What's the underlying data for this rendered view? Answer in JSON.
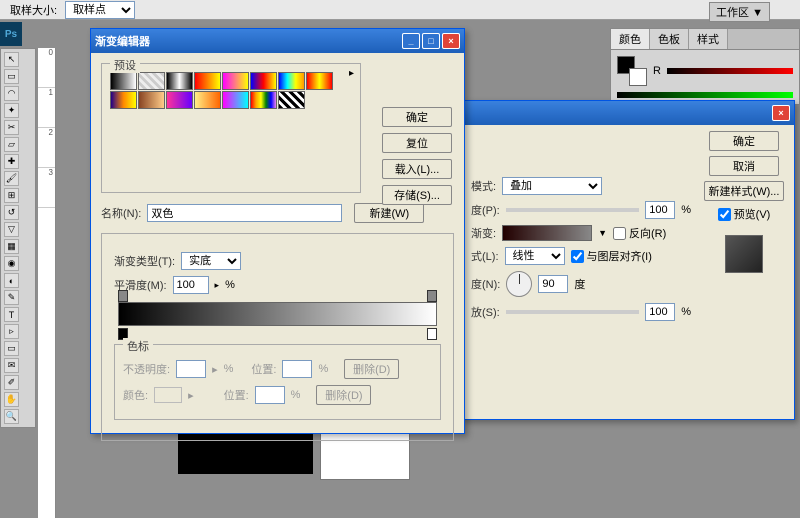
{
  "topbar": {
    "sampleSizeLabel": "取样大小:",
    "sampleSizeValue": "取样点",
    "workspaceLabel": "工作区 ▼"
  },
  "psIcon": "Ps",
  "rulerMarks": [
    "0",
    "1",
    "2",
    "3"
  ],
  "blackRectLabel": "",
  "gradientEditor": {
    "title": "渐变编辑器",
    "presetLegend": "预设",
    "buttons": {
      "ok": "确定",
      "reset": "复位",
      "load": "载入(L)...",
      "save": "存储(S)...",
      "new": "新建(W)"
    },
    "nameLabel": "名称(N):",
    "nameValue": "双色",
    "typeLabel": "渐变类型(T):",
    "typeValue": "实底",
    "smoothLabel": "平滑度(M):",
    "smoothValue": "100",
    "percent": "%",
    "stopsLegend": "色标",
    "opacityLabel": "不透明度:",
    "posLabel": "位置:",
    "deleteLabel": "删除(D)",
    "colorLabel": "颜色:"
  },
  "layerStyle": {
    "ok": "确定",
    "cancel": "取消",
    "newStyle": "新建样式(W)...",
    "previewChk": "预览(V)",
    "modeLabel": "模式:",
    "modeValue": "叠加",
    "opacityLabel": "度(P):",
    "opacityValue": "100",
    "percent": "%",
    "gradLabel": "渐变:",
    "reverseLabel": "反向(R)",
    "styleLabel": "式(L):",
    "styleValue": "线性",
    "alignLabel": "与图层对齐(I)",
    "angleLabel": "度(N):",
    "angleValue": "90",
    "angleUnit": "度",
    "scaleLabel": "放(S):",
    "scaleValue": "100"
  },
  "colorPanel": {
    "tabs": [
      "颜色",
      "色板",
      "样式"
    ],
    "rLabel": "R"
  }
}
